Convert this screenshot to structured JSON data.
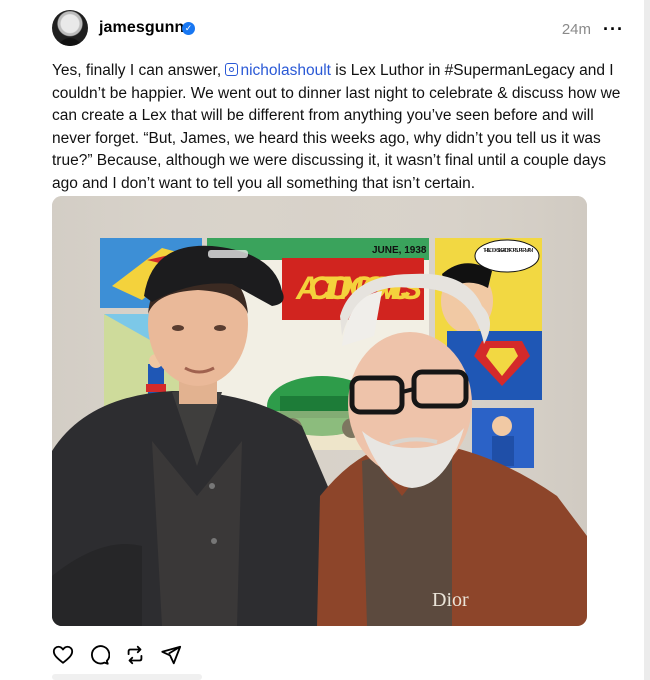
{
  "post": {
    "username": "jamesgunn",
    "verified": true,
    "timestamp": "24m",
    "more_icon": "more-horizontal-icon",
    "caption_before": "Yes, finally I can answer, ",
    "mention": "nicholashoult",
    "caption_after": " is Lex Luthor in #SupermanLegacy and I couldn’t be happier. We went out to dinner last night to celebrate & discuss how we can create a Lex that will be different from anything you’ve seen before and will never forget. “But, James, we heard this weeks ago, why didn’t you tell us it was true?” Because, although we were discussing it, it wasn’t final until a couple days ago and I don’t want to tell you all something that isn’t certain.",
    "photo": {
      "comic_date": "JUNE, 1938",
      "comic_title": "ACTION COMICS",
      "comic_bubble": "THIS LOOKS LIKE A JOB FOR SUPERMAN!",
      "shirt_text": "Dior"
    },
    "actions": [
      "heart-icon",
      "comment-icon",
      "repost-icon",
      "share-icon"
    ]
  },
  "colors": {
    "mention": "#2a59d6",
    "verified": "#1877f2"
  }
}
